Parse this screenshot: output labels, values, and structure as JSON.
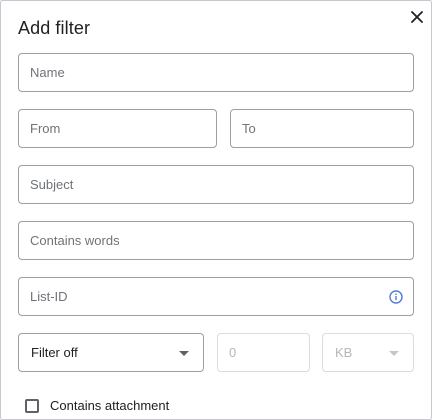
{
  "dialog": {
    "title": "Add filter",
    "close_icon": "close-icon"
  },
  "fields": {
    "name": {
      "placeholder": "Name"
    },
    "from": {
      "placeholder": "From"
    },
    "to": {
      "placeholder": "To"
    },
    "subject": {
      "placeholder": "Subject"
    },
    "contains_words": {
      "placeholder": "Contains words"
    },
    "list_id": {
      "placeholder": "List-ID",
      "icon": "info-icon"
    }
  },
  "size": {
    "operator_selected": "Filter off",
    "value_placeholder": "0",
    "unit_selected": "KB"
  },
  "attachment": {
    "label": "Contains attachment",
    "checked": false
  },
  "colors": {
    "accent": "#4f7cd6",
    "border": "#9aa0a6",
    "disabled_border": "#dadce0"
  }
}
